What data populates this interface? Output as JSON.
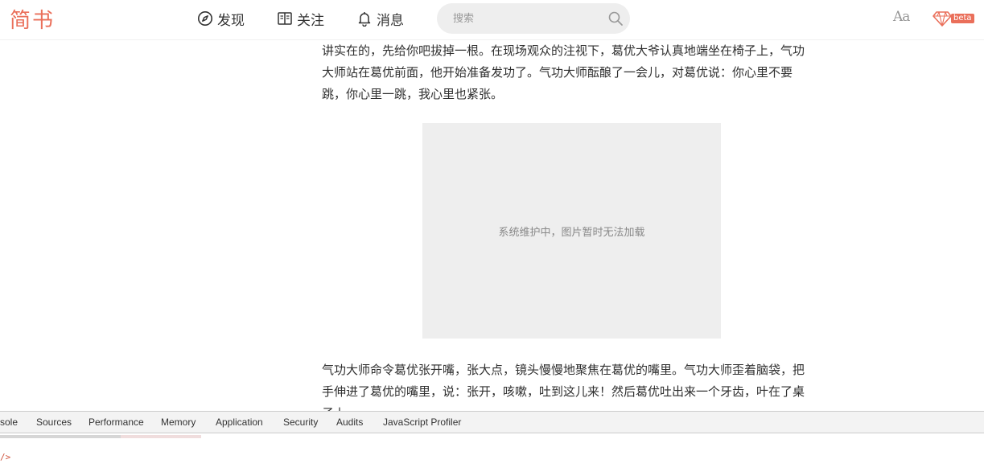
{
  "nav": {
    "logo": "简书",
    "items": [
      {
        "label": "发现",
        "icon": "compass-icon"
      },
      {
        "label": "关注",
        "icon": "book-icon"
      },
      {
        "label": "消息",
        "icon": "bell-icon"
      }
    ],
    "search": {
      "placeholder": "搜索"
    },
    "font_toggle": "Aa",
    "beta_label": "beta",
    "accent_color": "#ea6f5a"
  },
  "article": {
    "paragraph_1": "讲实在的，先给你吧拔掉一根。在现场观众的注视下，葛优大爷认真地端坐在椅子上，气功大师站在葛优前面，他开始准备发功了。气功大师酝酿了一会儿，对葛优说：你心里不要跳，你心里一跳，我心里也紧张。",
    "image_placeholder": "系统维护中，图片暂时无法加载",
    "paragraph_2": "气功大师命令葛优张开嘴，张大点，镜头慢慢地聚焦在葛优的嘴里。气功大师歪着脑袋，把手伸进了葛优的嘴里，说：张开，咳嗽，吐到这儿来！然后葛优吐出来一个牙齿，叶在了桌子上"
  },
  "devtools": {
    "tabs": [
      "sole",
      "Sources",
      "Performance",
      "Memory",
      "Application",
      "Security",
      "Audits",
      "JavaScript Profiler"
    ],
    "prompt": "/>"
  }
}
